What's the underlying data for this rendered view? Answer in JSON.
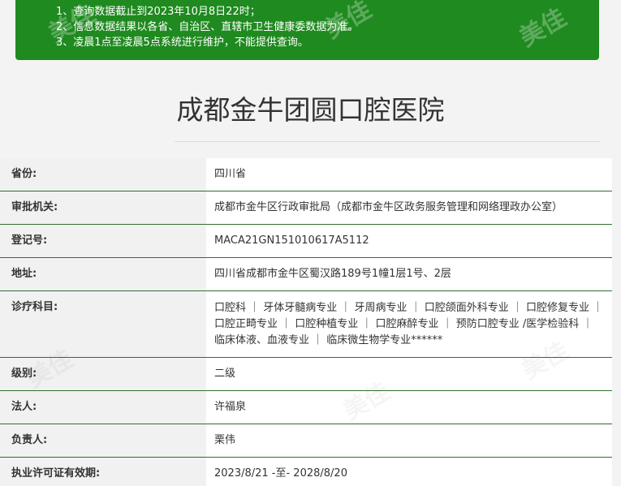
{
  "notice": {
    "lines": [
      "1、查询数据截止到2023年10月8日22时；",
      "2、信息数据结果以各省、自治区、直辖市卫生健康委数据为准。",
      "3、凌晨1点至凌晨5点系统进行维护，不能提供查询。"
    ]
  },
  "hospital": {
    "name": "成都金牛团圆口腔医院"
  },
  "watermark": {
    "text": "美佳"
  },
  "fields": [
    {
      "label": "省份:",
      "value": "四川省"
    },
    {
      "label": "审批机关:",
      "value": "成都市金牛区行政审批局（成都市金牛区政务服务管理和网络理政办公室）"
    },
    {
      "label": "登记号:",
      "value": "MACA21GN151010617A5112"
    },
    {
      "label": "地址:",
      "value": "四川省成都市金牛区蜀汉路189号1幢1层1号、2层"
    },
    {
      "label": "诊疗科目:",
      "value": "口腔科 ｜ 牙体牙髓病专业 ｜ 牙周病专业 ｜ 口腔颌面外科专业 ｜ 口腔修复专业 ｜ 口腔正畸专业 ｜ 口腔种植专业 ｜ 口腔麻醉专业 ｜ 预防口腔专业 /医学检验科 ｜ 临床体液、血液专业 ｜ 临床微生物学专业******"
    },
    {
      "label": "级别:",
      "value": "二级"
    },
    {
      "label": "法人:",
      "value": "许福泉"
    },
    {
      "label": "负责人:",
      "value": "栗伟"
    },
    {
      "label": "执业许可证有效期:",
      "value": "2023/8/21 -至- 2028/8/20"
    }
  ]
}
